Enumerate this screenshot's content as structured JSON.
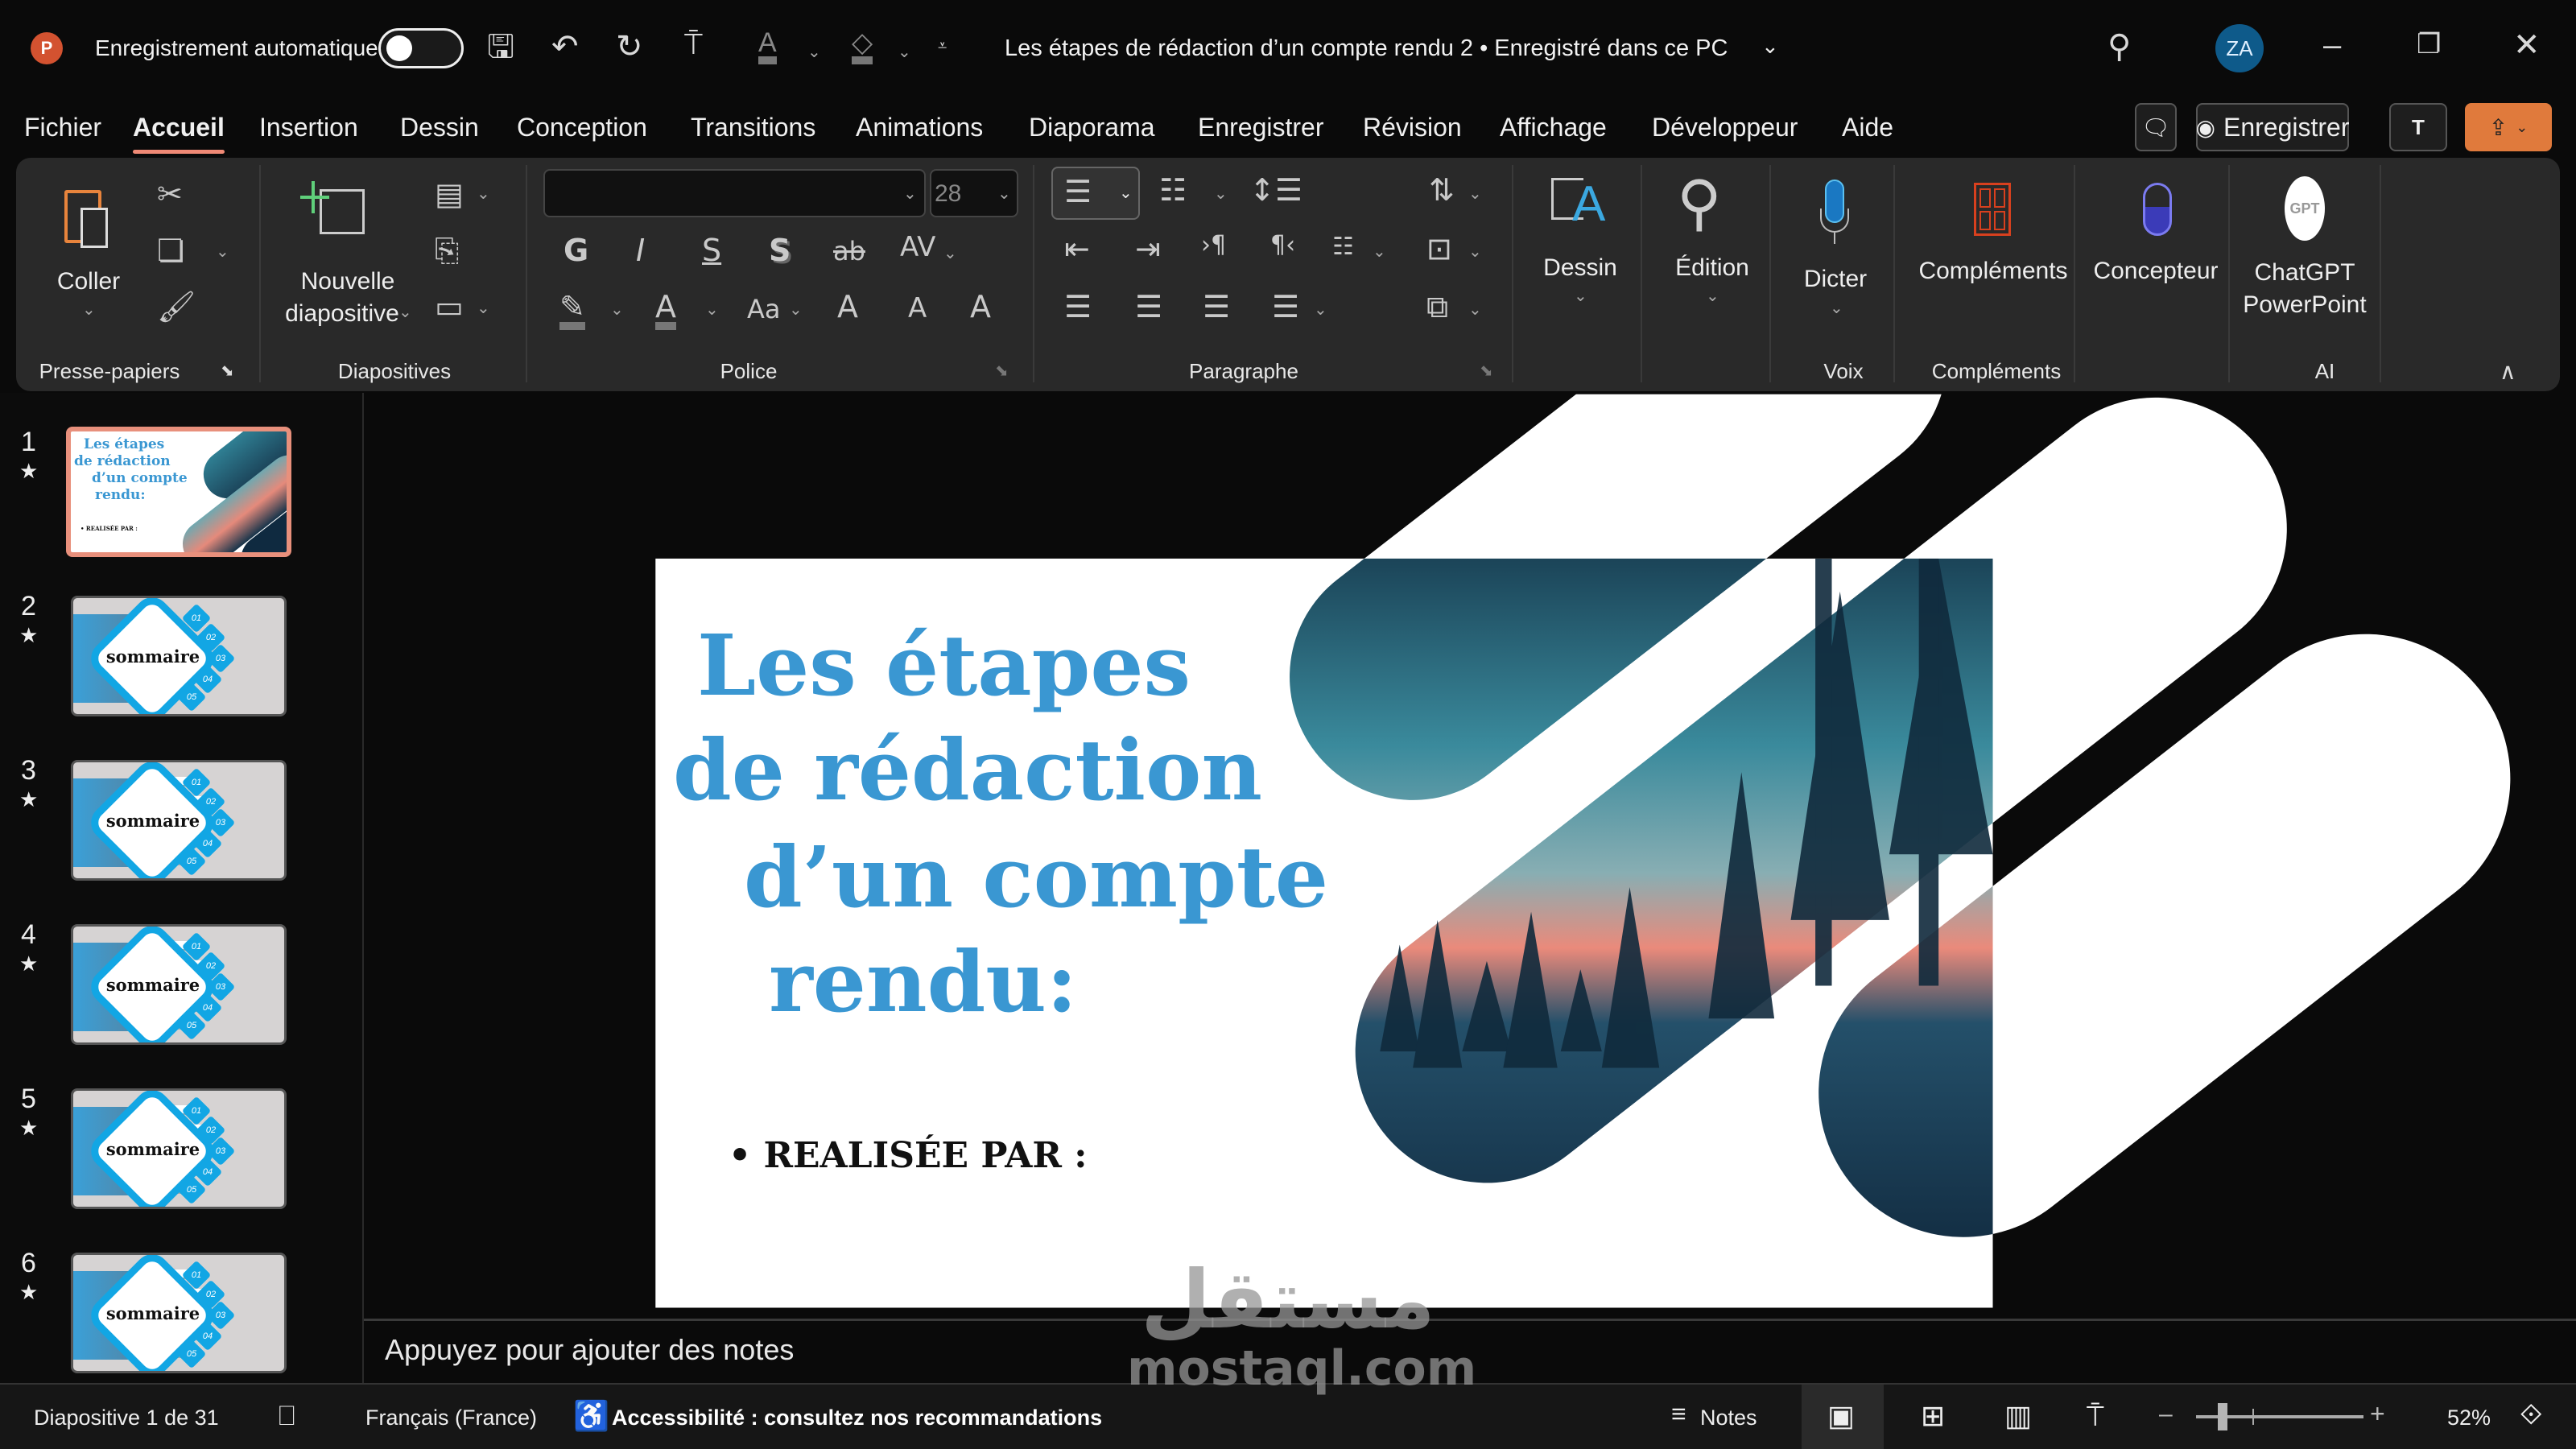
{
  "titlebar": {
    "app_icon": "powerpoint-logo",
    "autosave_label": "Enregistrement automatique",
    "autosave_on": false,
    "doc_title": "Les étapes de  rédaction d’un compte rendu 2 • Enregistré dans ce PC",
    "avatar_initials": "ZA",
    "avatar_color": "#0e5a8a"
  },
  "tabs": [
    "Fichier",
    "Accueil",
    "Insertion",
    "Dessin",
    "Conception",
    "Transitions",
    "Animations",
    "Diaporama",
    "Enregistrer",
    "Révision",
    "Affichage",
    "Développeur",
    "Aide"
  ],
  "active_tab": "Accueil",
  "header_buttons": {
    "record_label": "Enregistrer",
    "share_color": "#e07a3c"
  },
  "ribbon": {
    "groups": [
      "Presse-papiers",
      "Diapositives",
      "Police",
      "Paragraphe",
      "Voix",
      "Compléments",
      "AI"
    ],
    "paste_label": "Coller",
    "new_slide_label": [
      "Nouvelle",
      "diapositive"
    ],
    "font_name": "",
    "font_size": "28",
    "font_glyphs": [
      "G",
      "I",
      "S",
      "S",
      "ab",
      "AV",
      "A",
      "Aa",
      "A",
      "A",
      "A"
    ],
    "drawing_label": "Dessin",
    "editing_label": "Édition",
    "dictate_label": "Dicter",
    "addins_label": "Compléments",
    "designer_label": "Concepteur",
    "chatgpt_label": [
      "ChatGPT",
      "PowerPoint"
    ],
    "chatgpt_logo": "GPT"
  },
  "slides_pane": {
    "numbers": [
      "1",
      "2",
      "3",
      "4",
      "5",
      "6"
    ],
    "selected": 1
  },
  "thumb": {
    "title_lines": [
      "Les étapes",
      "de rédaction",
      "d’un compte",
      "rendu:"
    ],
    "subtitle": "• REALISÉE PAR :",
    "sommaire": "sommaire",
    "items": [
      "01",
      "02",
      "03",
      "04",
      "05"
    ]
  },
  "slide": {
    "title_lines": [
      "Les étapes",
      "de rédaction",
      "d’un compte",
      "rendu:"
    ],
    "subtitle": "• REALISÉE PAR :",
    "title_color": "#3a97d2"
  },
  "notes": {
    "placeholder": "Appuyez pour ajouter des notes"
  },
  "status": {
    "slide_counter": "Diapositive 1 de 31",
    "language": "Français (France)",
    "accessibility": "Accessibilité : consultez nos recommandations",
    "notes_label": "Notes",
    "zoom": "52%",
    "zoom_percent": 52
  },
  "watermark": {
    "arabic": "مستقل",
    "latin": "mostaql.com"
  }
}
